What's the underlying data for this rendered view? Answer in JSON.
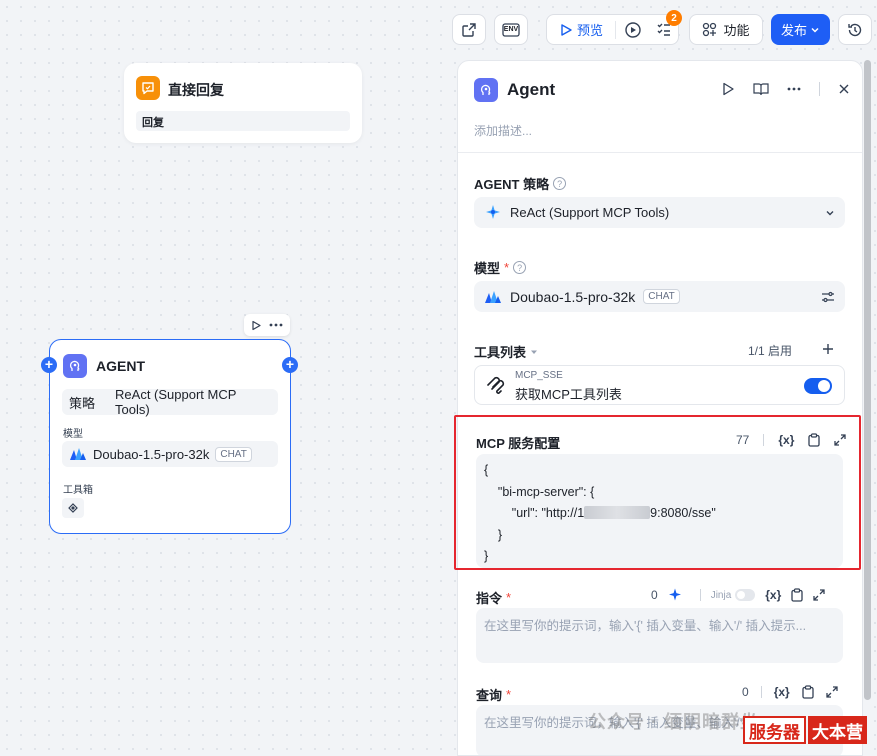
{
  "toolbar": {
    "env_label": "ENV",
    "preview_label": "预览",
    "checklist_badge": "2",
    "features_label": "功能",
    "publish_label": "发布"
  },
  "reply_node": {
    "title": "直接回复",
    "field": "回复"
  },
  "agent_node": {
    "title": "AGENT",
    "strategy_key": "策略",
    "strategy_value": "ReAct (Support MCP Tools)",
    "model_label": "模型",
    "model_name": "Doubao-1.5-pro-32k",
    "model_tag": "CHAT",
    "toolbox_label": "工具箱"
  },
  "panel": {
    "title": "Agent",
    "description_placeholder": "添加描述...",
    "strategy_label": "AGENT 策略",
    "strategy_value": "ReAct (Support MCP Tools)",
    "model_label": "模型",
    "model_name": "Doubao-1.5-pro-32k",
    "model_tag": "CHAT",
    "tools_label": "工具列表",
    "tools_enabled": "1/1 启用",
    "tool": {
      "provider": "MCP_SSE",
      "name": "获取MCP工具列表",
      "enabled": true
    },
    "mcp_config": {
      "label": "MCP 服务配置",
      "count": "77",
      "line1": "{",
      "line2": "    \"bi-mcp-server\": {",
      "line3_prefix": "        \"url\": \"http://1",
      "line3_suffix": "9:8080/sse\"",
      "line4": "    }",
      "line5": "}"
    },
    "instruction": {
      "label": "指令",
      "count": "0",
      "jinja_label": "Jinja",
      "placeholder": "在这里写你的提示词，输入'{' 插入变量、输入'/' 插入提示..."
    },
    "query": {
      "label": "查询",
      "count": "0",
      "placeholder": "在这里写你的提示词，输入'{' 插入变量、输入'/' 插入提示..."
    }
  },
  "watermark": {
    "text": "公众号 · 缅阴暗群坐",
    "badge_left": "服务器",
    "badge_right": "大本营"
  },
  "colors": {
    "accent": "#1e5ef5",
    "agent_icon": "#6172f3",
    "reply_icon": "#f79009",
    "highlight": "#e5262f"
  }
}
